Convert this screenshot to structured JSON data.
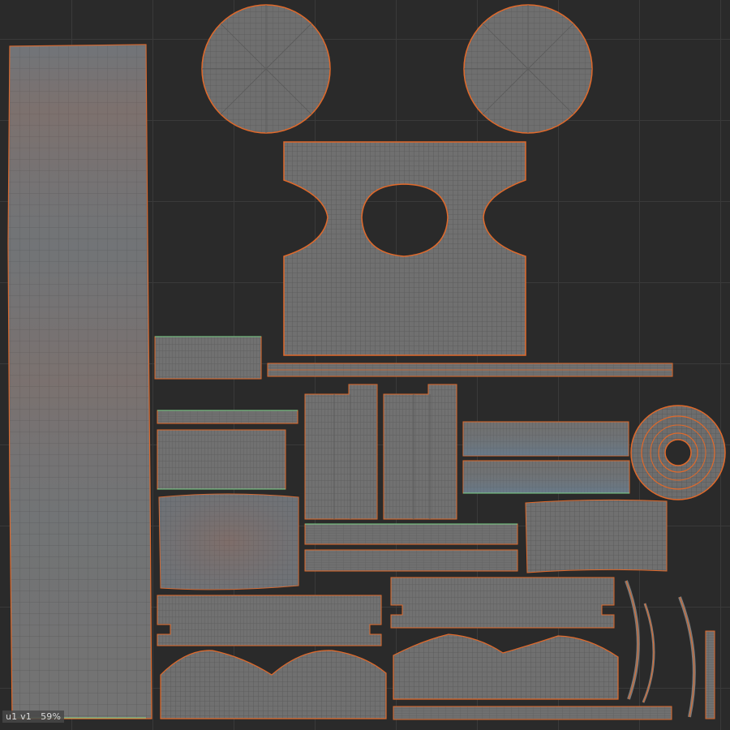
{
  "status": {
    "udim_u": "u1",
    "udim_v": "v1",
    "zoom": "59%"
  },
  "colors": {
    "background": "#2a2a2a",
    "grid_line": "#3a3a3a",
    "island_fill": "#6e6e6e",
    "mesh_line": "#575757",
    "border_seam": "#e0692a",
    "open_edge": "#7fd48a",
    "stretch_warm": "#8a6e6a",
    "stretch_cool": "#6a7a8c"
  },
  "icons": {
    "udim-indicator": "text-readout"
  }
}
